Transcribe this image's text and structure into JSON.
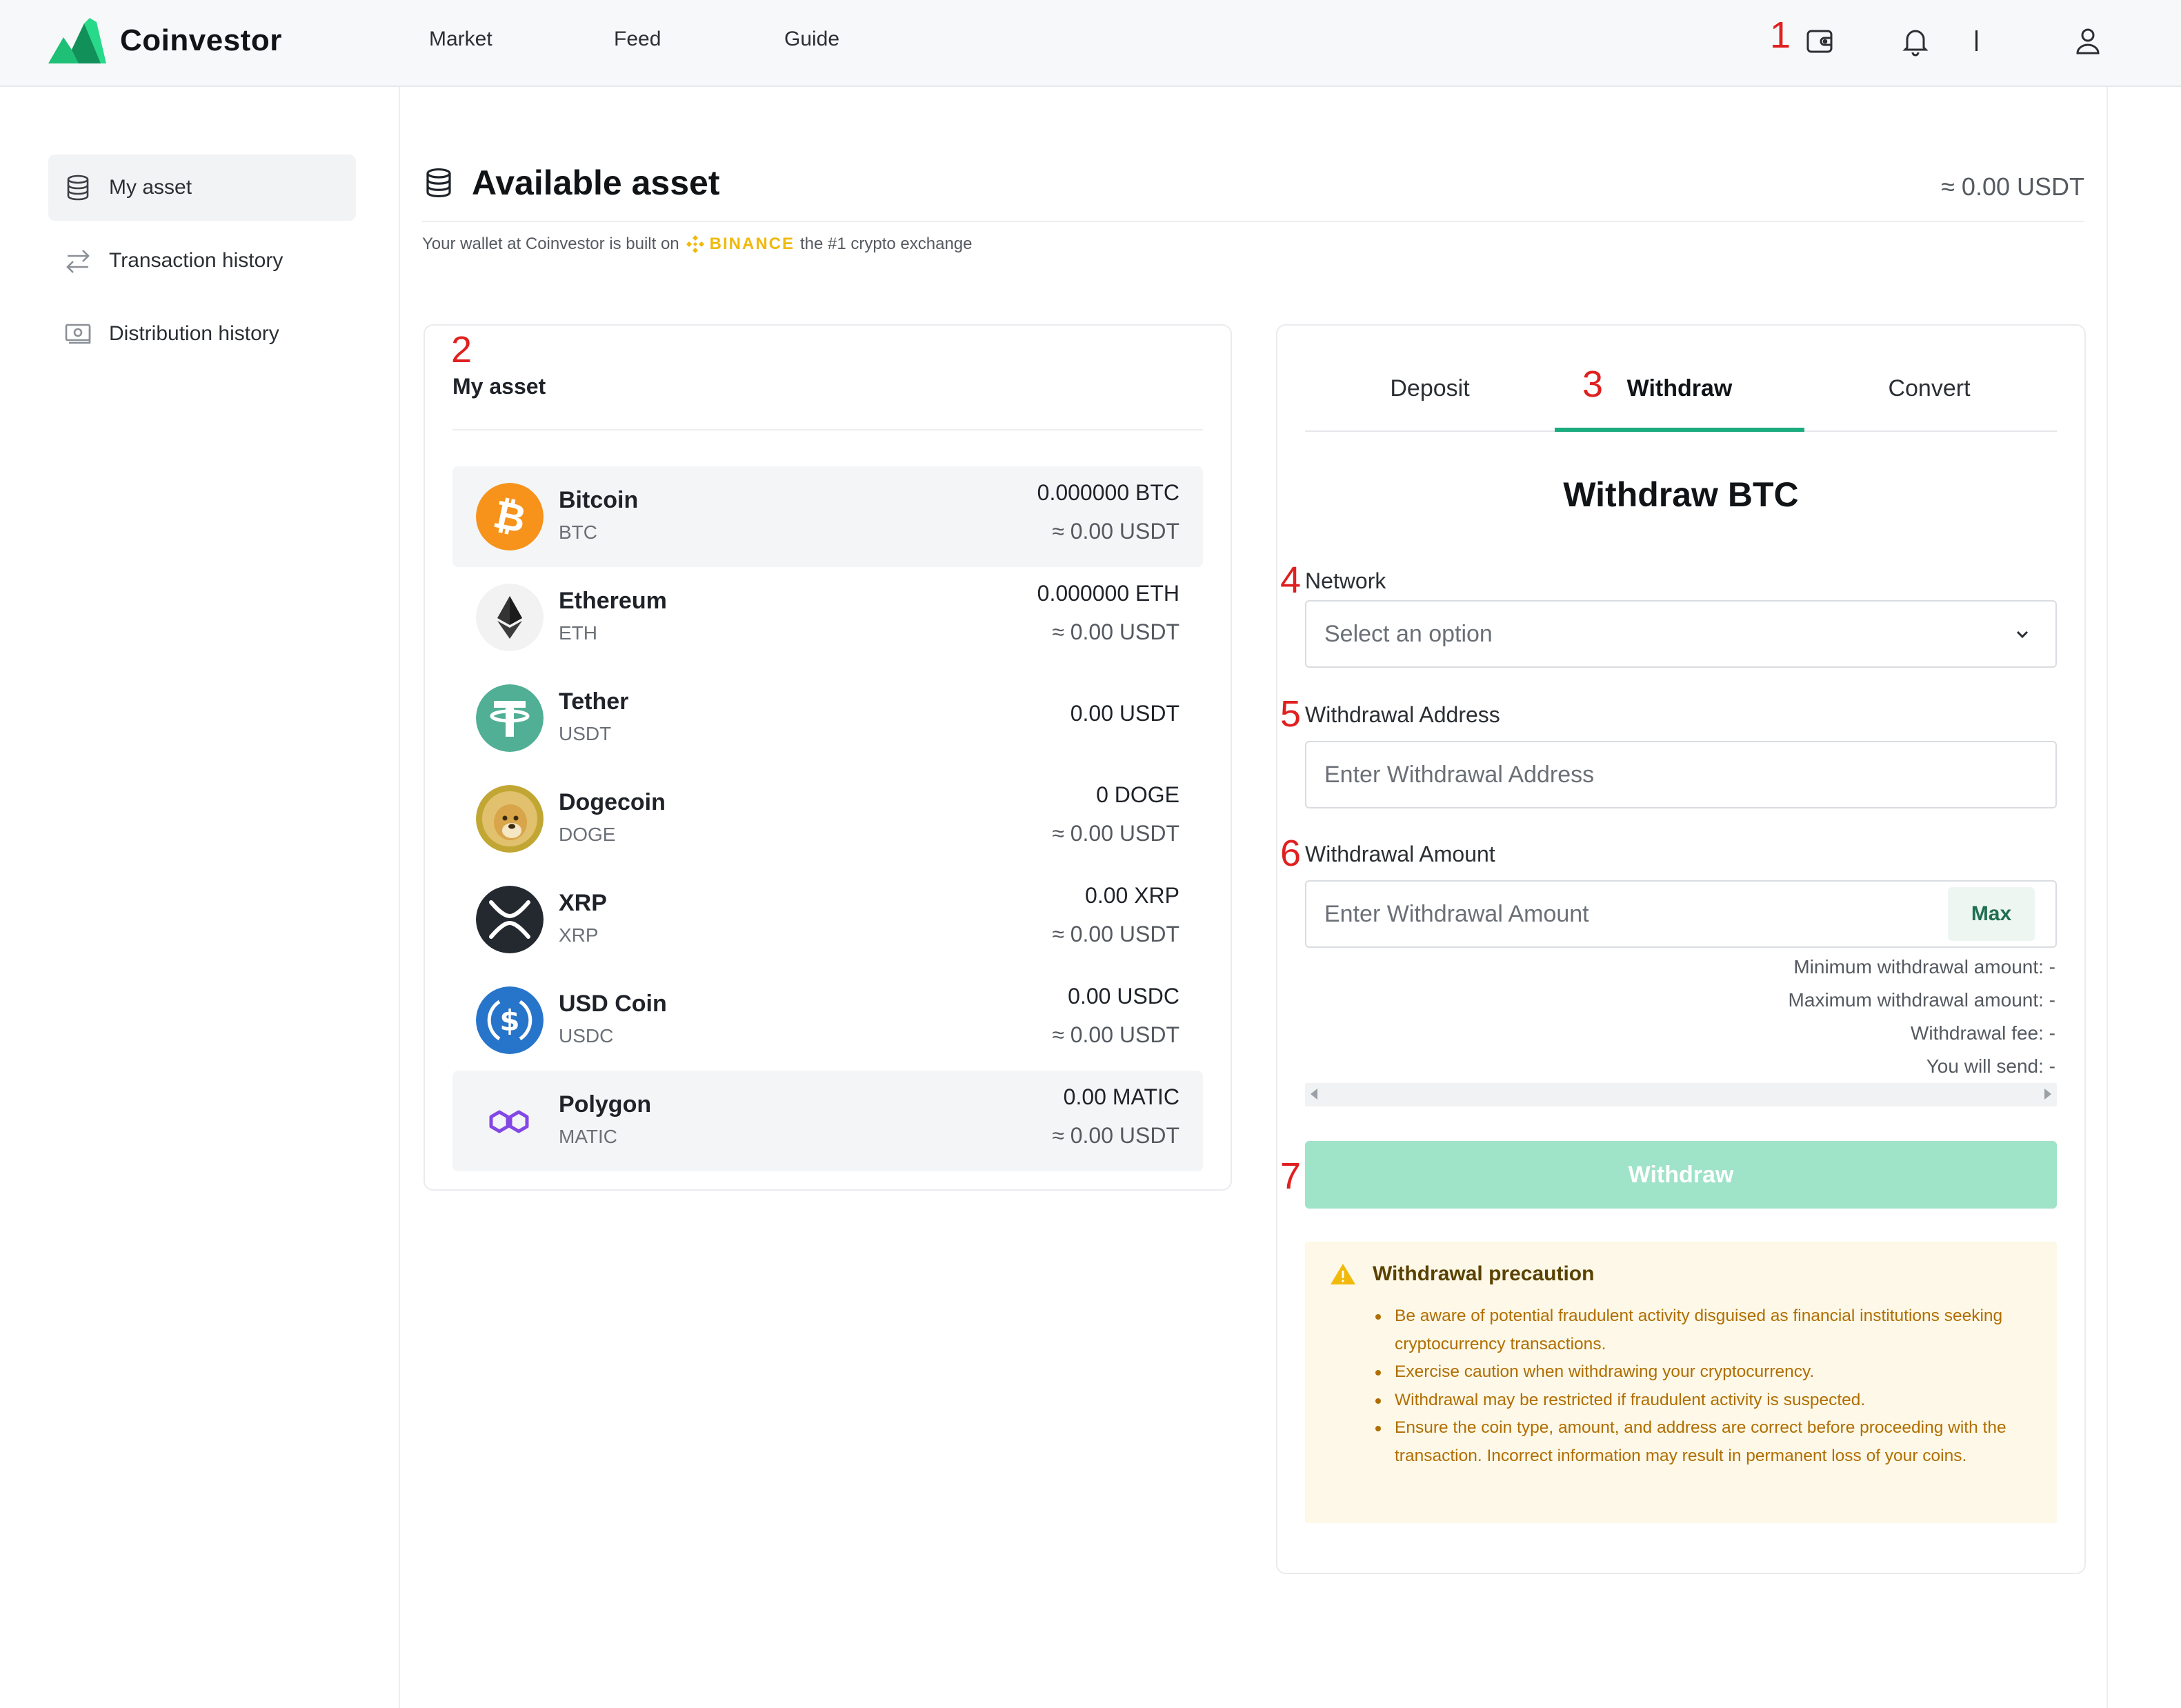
{
  "header": {
    "logo_text": "Coinvestor",
    "nav": {
      "market": "Market",
      "feed": "Feed",
      "guide": "Guide"
    },
    "divider": "|"
  },
  "annotations": [
    "1",
    "2",
    "3",
    "4",
    "5",
    "6",
    "7"
  ],
  "sidebar": {
    "items": [
      {
        "label": "My asset",
        "icon": "database-icon",
        "active": true
      },
      {
        "label": "Transaction history",
        "icon": "transfer-arrows-icon",
        "active": false
      },
      {
        "label": "Distribution history",
        "icon": "cash-icon",
        "active": false
      }
    ]
  },
  "main": {
    "title": "Available asset",
    "total": "≈ 0.00 USDT",
    "subtitle_before": "Your wallet at Coinvestor is built on",
    "binance": "BINANCE",
    "subtitle_after": "the #1 crypto exchange"
  },
  "asset_card": {
    "title": "My asset",
    "assets": [
      {
        "name": "Bitcoin",
        "symbol": "BTC",
        "amount": "0.000000 BTC",
        "usdt": "≈ 0.00 USDT",
        "color": "#f7931a"
      },
      {
        "name": "Ethereum",
        "symbol": "ETH",
        "amount": "0.000000 ETH",
        "usdt": "≈ 0.00 USDT",
        "color": "#f2f2f2"
      },
      {
        "name": "Tether",
        "symbol": "USDT",
        "amount": "0.00 USDT",
        "usdt": "",
        "color": "#50af95"
      },
      {
        "name": "Dogecoin",
        "symbol": "DOGE",
        "amount": "0 DOGE",
        "usdt": "≈ 0.00 USDT",
        "color": "#c2a633"
      },
      {
        "name": "XRP",
        "symbol": "XRP",
        "amount": "0.00 XRP",
        "usdt": "≈ 0.00 USDT",
        "color": "#23292f"
      },
      {
        "name": "USD Coin",
        "symbol": "USDC",
        "amount": "0.00 USDC",
        "usdt": "≈ 0.00 USDT",
        "color": "#2775ca"
      },
      {
        "name": "Polygon",
        "symbol": "MATIC",
        "amount": "0.00 MATIC",
        "usdt": "≈ 0.00 USDT",
        "color": "#8247e5"
      }
    ]
  },
  "withdraw_card": {
    "tabs": {
      "deposit": "Deposit",
      "withdraw": "Withdraw",
      "convert": "Convert"
    },
    "title": "Withdraw BTC",
    "network_label": "Network",
    "network_value": "Select an option",
    "address_label": "Withdrawal Address",
    "address_placeholder": "Enter Withdrawal Address",
    "amount_label": "Withdrawal Amount",
    "amount_placeholder": "Enter Withdrawal Amount",
    "max_label": "Max",
    "min_line": "Minimum withdrawal amount: -",
    "max_line": "Maximum withdrawal amount: -",
    "fee_line": "Withdrawal fee: -",
    "send_line": "You will send: -",
    "submit_label": "Withdraw",
    "precaution_title": "Withdrawal precaution",
    "precautions": [
      "Be aware of potential fraudulent activity disguised as financial institutions seeking cryptocurrency transactions.",
      "Exercise caution when withdrawing your cryptocurrency.",
      "Withdrawal may be restricted if fraudulent activity is suspected.",
      "Ensure the coin type, amount, and address are correct before proceeding with the transaction. Incorrect information may result in permanent loss of your coins."
    ]
  },
  "colors": {
    "accent": "#1aab7e",
    "button_disabled": "#9fe3c8",
    "warning_bg": "#fdf8e7",
    "warning_text": "#b06e00",
    "binance": "#f0b90b"
  }
}
